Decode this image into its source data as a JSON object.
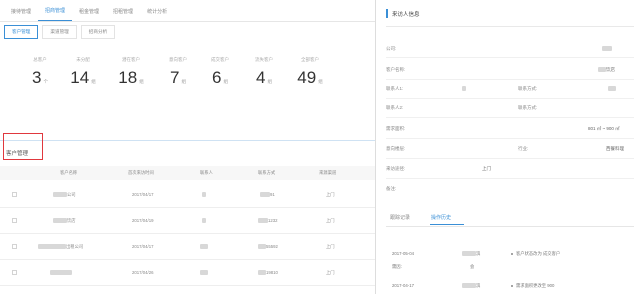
{
  "top_tabs": [
    "接待管理",
    "招商管理",
    "租金管理",
    "招租管理",
    "统计分析"
  ],
  "sub_tabs": [
    "客户管理",
    "渠道管理",
    "招商分析"
  ],
  "stats": [
    {
      "label": "总客户",
      "value": "3",
      "unit": "个"
    },
    {
      "label": "未分配",
      "value": "14",
      "unit": "组"
    },
    {
      "label": "潜在客户",
      "value": "18",
      "unit": "组"
    },
    {
      "label": "意向客户",
      "value": "7",
      "unit": "组"
    },
    {
      "label": "成交客户",
      "value": "6",
      "unit": "组"
    },
    {
      "label": "流失客户",
      "value": "4",
      "unit": "组"
    },
    {
      "label": "全部客户",
      "value": "49",
      "unit": "组"
    }
  ],
  "section_title": "客户管理",
  "table": {
    "columns": [
      "客户名称",
      "首次来访时间",
      "联系人",
      "联系方式",
      "来源渠道"
    ],
    "rows": [
      {
        "name": "公司",
        "date": "2017/04/17",
        "contact": "",
        "phone": "91",
        "source": "上门"
      },
      {
        "name": "饮店",
        "date": "2017/04/19",
        "contact": "",
        "phone": "1232",
        "source": "上门"
      },
      {
        "name": "出租公司",
        "date": "2017/04/17",
        "contact": "",
        "phone": "55592",
        "source": "上门"
      },
      {
        "name": "",
        "date": "2017/04/26",
        "contact": "",
        "phone": "19810",
        "source": "上门"
      }
    ]
  },
  "detail": {
    "title": "来访人信息",
    "fields": [
      {
        "label": "公司:",
        "value": ""
      },
      {
        "label": "客户名称:",
        "value": "饮店"
      },
      {
        "label": "联系人1:",
        "value": ""
      },
      {
        "label": "联系方式:",
        "value": ""
      },
      {
        "label": "联系人2:",
        "value": ""
      },
      {
        "label": "联系方式:",
        "value": ""
      },
      {
        "label": "需求面积:",
        "value": "801 ㎡ ~ 900 ㎡"
      },
      {
        "label": "意向楼层:",
        "value": ""
      },
      {
        "label": "行业:",
        "value": "西餐料理"
      },
      {
        "label": "来访途径:",
        "value": "上门"
      },
      {
        "label": "备注:",
        "value": ""
      }
    ],
    "tabs": [
      "跟踪记录",
      "操作历史"
    ],
    "log": [
      {
        "date": "2017-05-04",
        "user": "滨",
        "action": "客户状态改为 成交客户"
      },
      {
        "date": "",
        "user": "",
        "action": "需因:"
      },
      {
        "date": "",
        "user": "",
        "action": "会"
      },
      {
        "date": "2017-04-17",
        "user": "滨",
        "action": "需求面积更改至 900"
      }
    ]
  }
}
